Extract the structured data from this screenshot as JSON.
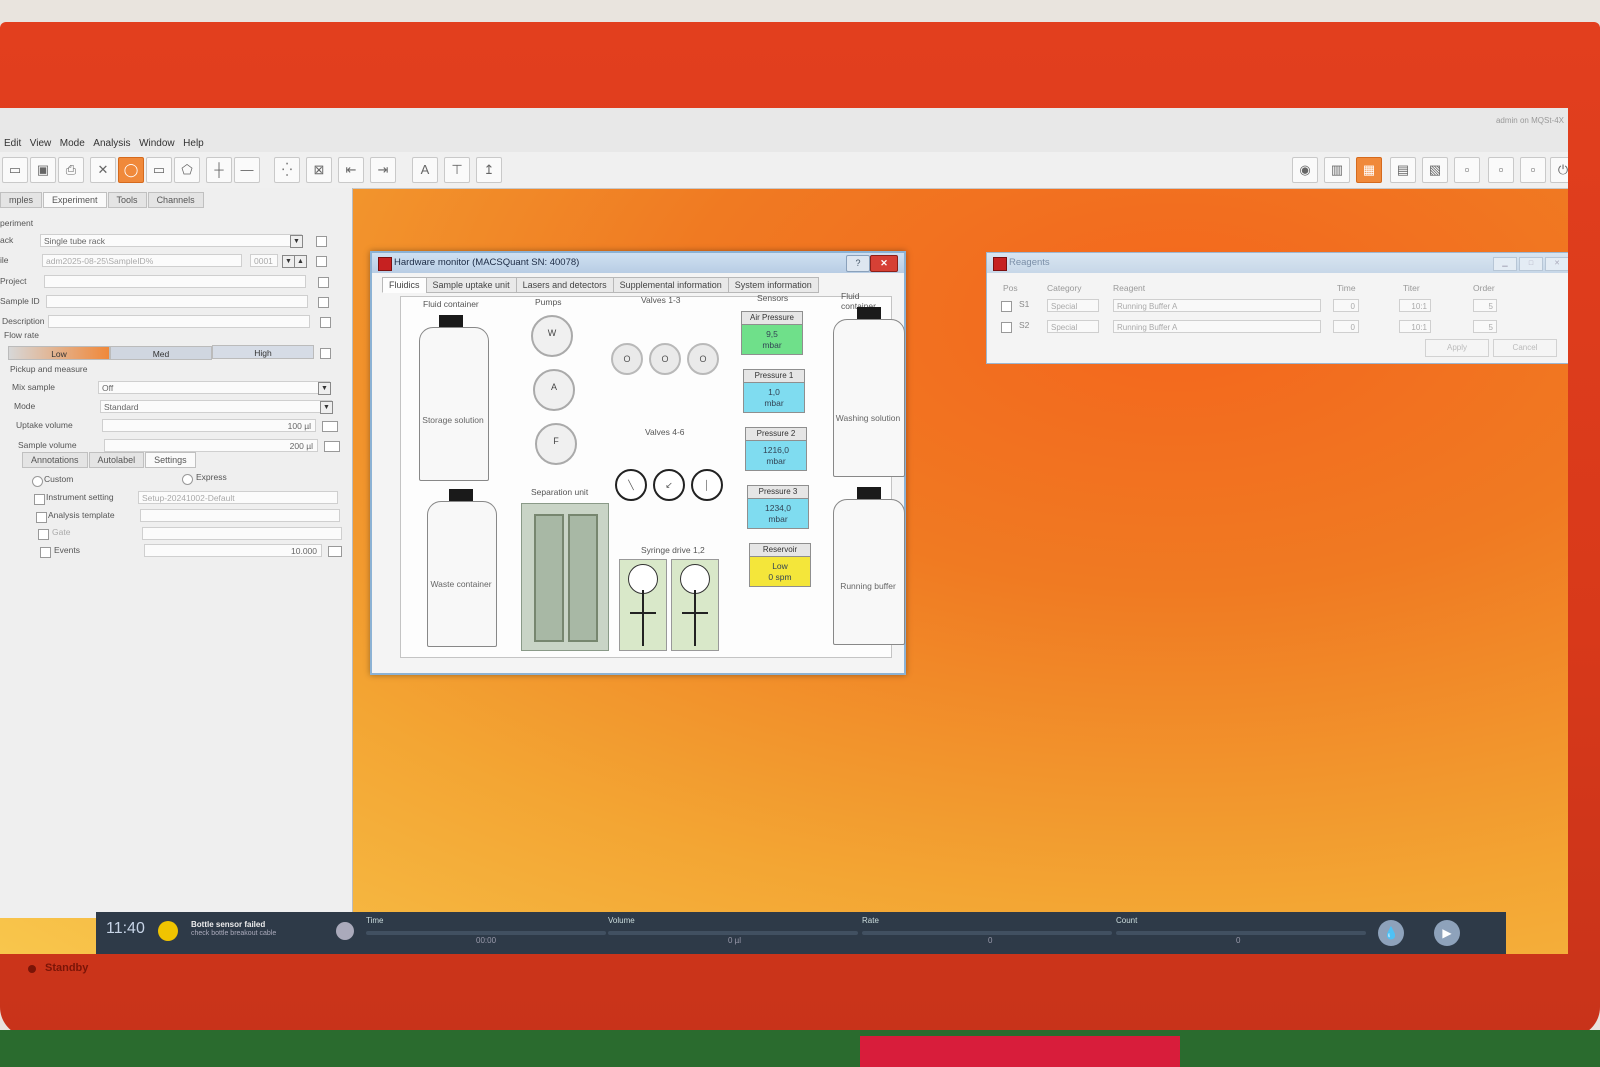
{
  "device": {
    "status_label": "Standby"
  },
  "menu": {
    "items": [
      "Edit",
      "View",
      "Mode",
      "Analysis",
      "Window",
      "Help"
    ],
    "user": "admin on MQSt-4X"
  },
  "left_panel": {
    "tabs": [
      "mples",
      "Experiment",
      "Tools",
      "Channels"
    ],
    "experiment_header": "periment",
    "rack_label": "ack",
    "rack_value": "Single tube rack",
    "file_label": "ile",
    "file_value": "adm2025-08-25\\SampleID%",
    "file_counter": "0001",
    "project_label": "Project",
    "sample_id_label": "Sample ID",
    "description_label": "Description",
    "flow_rate_label": "Flow rate",
    "flow_low": "Low",
    "flow_med": "Med",
    "flow_high": "High",
    "pickup_label": "Pickup and measure",
    "mix_label": "Mix sample",
    "mix_value": "Off",
    "mode_label": "Mode",
    "mode_value": "Standard",
    "uptake_label": "Uptake volume",
    "uptake_value": "100 µl",
    "sample_label": "Sample volume",
    "sample_value": "200 µl",
    "subtabs": [
      "Annotations",
      "Autolabel",
      "Settings"
    ],
    "custom_label": "Custom",
    "express_label": "Express",
    "instrument_label": "Instrument setting",
    "instrument_value": "Setup-20241002-Default",
    "analysis_label": "Analysis template",
    "gate_label": "Gate",
    "events_label": "Events",
    "events_value": "10.000"
  },
  "hardware_monitor": {
    "title": "Hardware monitor (MACSQuant SN: 40078)",
    "help_label": "?",
    "close_label": "✕",
    "tabs": [
      "Fluidics",
      "Sample uptake unit",
      "Lasers and detectors",
      "Supplemental information",
      "System information"
    ],
    "fluid_container_left": "Fluid container",
    "storage_solution": "Storage solution",
    "waste_container": "Waste container",
    "pumps_title": "Pumps",
    "pumps": [
      "W",
      "A",
      "F"
    ],
    "valves13_title": "Valves 1-3",
    "valves13": [
      "O",
      "O",
      "O"
    ],
    "valves46_title": "Valves 4-6",
    "separation_title": "Separation unit",
    "syringe_title": "Syringe drive 1,2",
    "sensors_title": "Sensors",
    "sensors": [
      {
        "name": "Air Pressure",
        "value": "9,5",
        "unit": "mbar",
        "color": "#6fe08a"
      },
      {
        "name": "Pressure 1",
        "value": "1,0",
        "unit": "mbar",
        "color": "#7fdcf0"
      },
      {
        "name": "Pressure 2",
        "value": "1216,0",
        "unit": "mbar",
        "color": "#7fdcf0"
      },
      {
        "name": "Pressure 3",
        "value": "1234,0",
        "unit": "mbar",
        "color": "#7fdcf0"
      },
      {
        "name": "Reservoir",
        "value": "Low",
        "unit": "0 spm",
        "color": "#f4e63a"
      }
    ],
    "fluid_container_right": "Fluid container",
    "washing_solution": "Washing solution",
    "running_buffer": "Running buffer"
  },
  "reagents": {
    "title": "Reagents",
    "headers": [
      "Pos",
      "Category",
      "Reagent",
      "Time",
      "Titer",
      "Order"
    ],
    "rows": [
      {
        "pos": "S1",
        "category": "Special",
        "reagent": "Running Buffer A",
        "time": "0",
        "titer": "10:1",
        "order": "5"
      },
      {
        "pos": "S2",
        "category": "Special",
        "reagent": "Running Buffer A",
        "time": "0",
        "titer": "10:1",
        "order": "5"
      }
    ],
    "apply_label": "Apply",
    "cancel_label": "Cancel"
  },
  "status_bar": {
    "clock": "11:40",
    "message": "Bottle sensor failed",
    "sub_message": "check bottle breakout cable",
    "time_label": "Time",
    "time_value": "00:00",
    "volume_label": "Volume",
    "volume_value": "0 µl",
    "rate_label": "Rate",
    "rate_value": "0",
    "count_label": "Count",
    "count_value": "0"
  }
}
